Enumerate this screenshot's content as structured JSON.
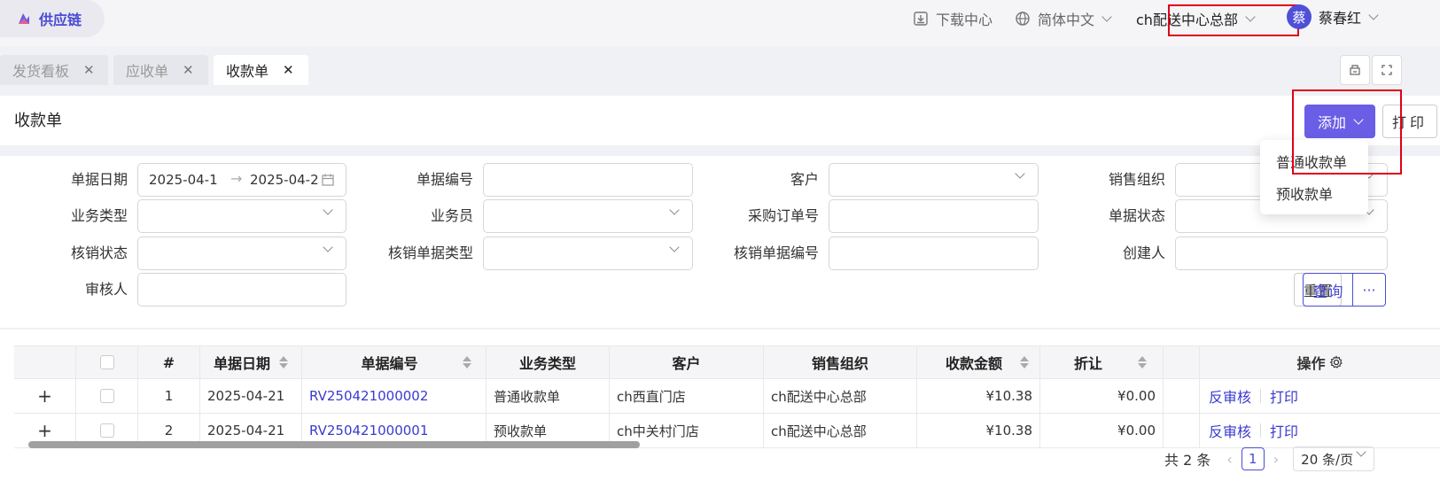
{
  "header": {
    "brand": "供应链",
    "download_center": "下载中心",
    "language": "简体中文",
    "org": "ch配送中心总部",
    "user_initial": "蔡",
    "user_name": "蔡春红"
  },
  "tabs": [
    {
      "label": "发货看板"
    },
    {
      "label": "应收单"
    },
    {
      "label": "收款单"
    }
  ],
  "page": {
    "title": "收款单",
    "add_label": "添加",
    "print_label": "打印"
  },
  "add_menu": [
    "普通收款单",
    "预收款单"
  ],
  "filters": {
    "doc_date": "单据日期",
    "date_start": "2025-04-1",
    "date_end": "2025-04-2",
    "doc_no": "单据编号",
    "customer": "客户",
    "sales_org": "销售组织",
    "biz_type": "业务类型",
    "salesperson": "业务员",
    "po_no": "采购订单号",
    "doc_status": "单据状态",
    "writeoff_status": "核销状态",
    "writeoff_doc_type": "核销单据类型",
    "writeoff_doc_no": "核销单据编号",
    "creator": "创建人",
    "reviewer": "审核人",
    "reset": "重置",
    "query": "查询",
    "more": "···"
  },
  "table": {
    "columns": [
      "#",
      "单据日期",
      "单据编号",
      "业务类型",
      "客户",
      "销售组织",
      "收款金额",
      "折让",
      "操作"
    ],
    "rows": [
      {
        "idx": "1",
        "date": "2025-04-21",
        "no": "RV250421000002",
        "type": "普通收款单",
        "customer": "ch西直门店",
        "org": "ch配送中心总部",
        "amount": "¥10.38",
        "discount": "¥0.00"
      },
      {
        "idx": "2",
        "date": "2025-04-21",
        "no": "RV250421000001",
        "type": "预收款单",
        "customer": "ch中关村门店",
        "org": "ch配送中心总部",
        "amount": "¥10.38",
        "discount": "¥0.00"
      }
    ],
    "op_unreview": "反审核",
    "op_print": "打印"
  },
  "pager": {
    "total": "共 2 条",
    "current": "1",
    "size": "20 条/页"
  }
}
